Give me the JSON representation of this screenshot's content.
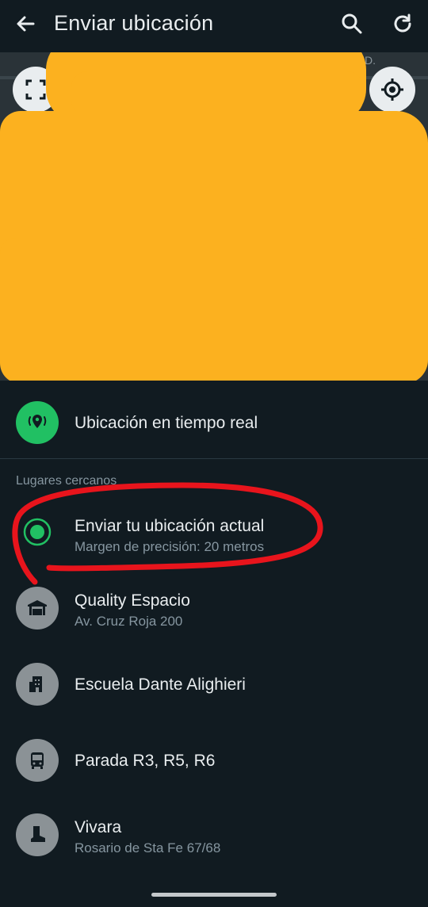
{
  "appbar": {
    "title": "Enviar ubicación",
    "back_icon": "arrow-back-icon",
    "search_icon": "search-icon",
    "refresh_icon": "refresh-icon"
  },
  "map": {
    "partial_text": "D.",
    "fullscreen_icon": "fullscreen-icon",
    "locate_icon": "my-location-icon"
  },
  "live_location": {
    "label": "Ubicación en tiempo real",
    "icon": "live-location-icon",
    "color": "#21c063"
  },
  "nearby": {
    "section_label": "Lugares cercanos",
    "current": {
      "title": "Enviar tu ubicación actual",
      "subtitle": "Margen de precisión: 20 metros",
      "icon": "current-location-icon"
    },
    "places": [
      {
        "name": "Quality Espacio",
        "address": "Av. Cruz Roja 200",
        "icon": "venue-icon"
      },
      {
        "name": "Escuela Dante Alighieri",
        "address": "",
        "icon": "building-icon"
      },
      {
        "name": "Parada R3, R5, R6",
        "address": "",
        "icon": "bus-icon"
      },
      {
        "name": "Vivara",
        "address": "Rosario de Sta Fe 67/68",
        "icon": "boot-icon"
      }
    ]
  },
  "colors": {
    "background": "#111b21",
    "accent": "#21c063",
    "redaction": "#fcb11f",
    "annotation": "#e8141c",
    "place_icon_bg": "#8b9296"
  }
}
